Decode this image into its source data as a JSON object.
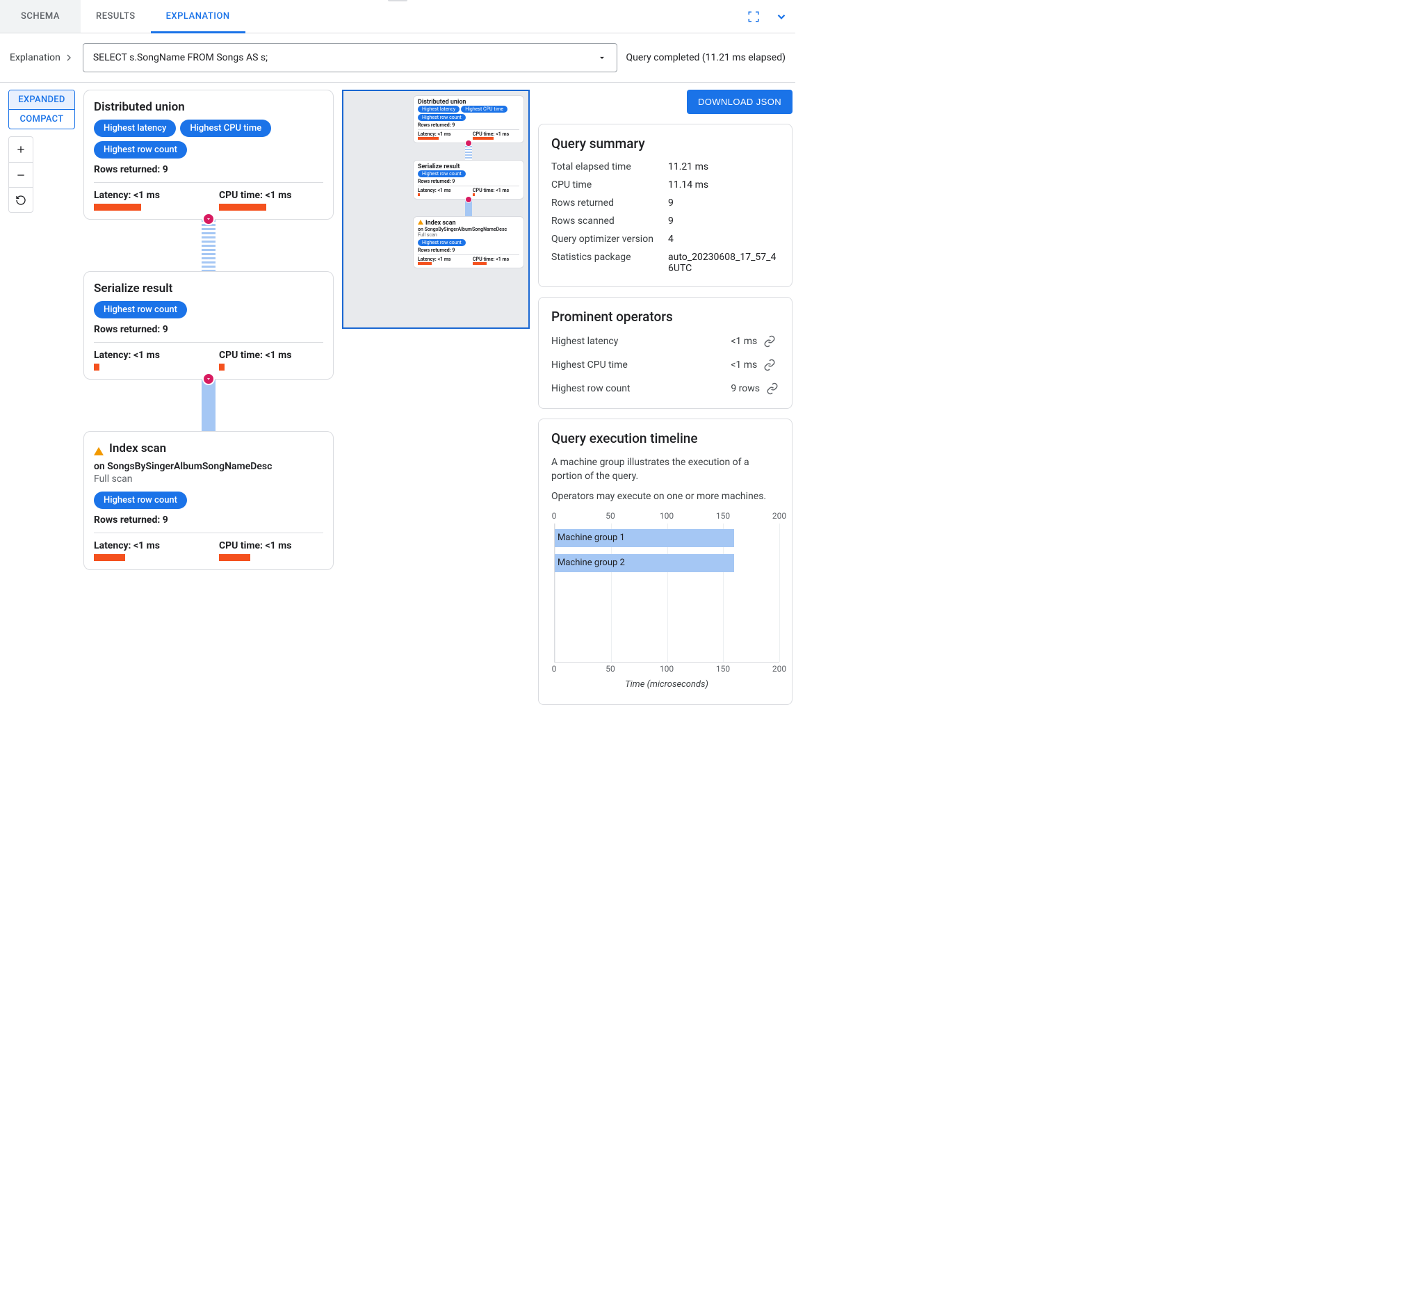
{
  "tabs": {
    "schema": "SCHEMA",
    "results": "RESULTS",
    "explanation": "EXPLANATION"
  },
  "breadcrumb": "Explanation",
  "query": "SELECT s.SongName FROM Songs AS s;",
  "status": "Query completed (11.21 ms elapsed)",
  "view_toggle": {
    "expanded": "EXPANDED",
    "compact": "COMPACT"
  },
  "download_btn": "DOWNLOAD JSON",
  "ops": [
    {
      "title": "Distributed union",
      "pills": [
        "Highest latency",
        "Highest CPU time",
        "Highest row count"
      ],
      "rows_label": "Rows returned: 9",
      "latency_label": "Latency: <1 ms",
      "cpu_label": "CPU time: <1 ms",
      "latency_frac": 0.45,
      "cpu_frac": 0.45,
      "connector": "hatched"
    },
    {
      "title": "Serialize result",
      "pills": [
        "Highest row count"
      ],
      "rows_label": "Rows returned: 9",
      "latency_label": "Latency: <1 ms",
      "cpu_label": "CPU time: <1 ms",
      "latency_frac": 0.05,
      "cpu_frac": 0.05,
      "connector": "solid"
    },
    {
      "title": "Index scan",
      "warn": true,
      "sub_on": "on SongsBySingerAlbumSongNameDesc",
      "sub_grey": "Full scan",
      "pills": [
        "Highest row count"
      ],
      "rows_label": "Rows returned: 9",
      "latency_label": "Latency: <1 ms",
      "cpu_label": "CPU time: <1 ms",
      "latency_frac": 0.3,
      "cpu_frac": 0.3
    }
  ],
  "summary": {
    "heading": "Query summary",
    "rows": [
      {
        "k": "Total elapsed time",
        "v": "11.21 ms"
      },
      {
        "k": "CPU time",
        "v": "11.14 ms"
      },
      {
        "k": "Rows returned",
        "v": "9"
      },
      {
        "k": "Rows scanned",
        "v": "9"
      },
      {
        "k": "Query optimizer version",
        "v": "4"
      },
      {
        "k": "Statistics package",
        "v": "auto_20230608_17_57_46UTC"
      }
    ]
  },
  "prominent": {
    "heading": "Prominent operators",
    "rows": [
      {
        "k": "Highest latency",
        "v": "<1 ms"
      },
      {
        "k": "Highest CPU time",
        "v": "<1 ms"
      },
      {
        "k": "Highest row count",
        "v": "9 rows"
      }
    ]
  },
  "timeline": {
    "heading": "Query execution timeline",
    "desc1": "A machine group illustrates the execution of a portion of the query.",
    "desc2": "Operators may execute on one or more machines.",
    "xlabel": "Time (microseconds)"
  },
  "chart_data": {
    "type": "bar",
    "orientation": "horizontal",
    "categories": [
      "Machine group 1",
      "Machine group 2"
    ],
    "values": [
      160,
      160
    ],
    "xlabel": "Time (microseconds)",
    "xlim": [
      0,
      200
    ],
    "ticks": [
      0,
      50,
      100,
      150,
      200
    ]
  }
}
